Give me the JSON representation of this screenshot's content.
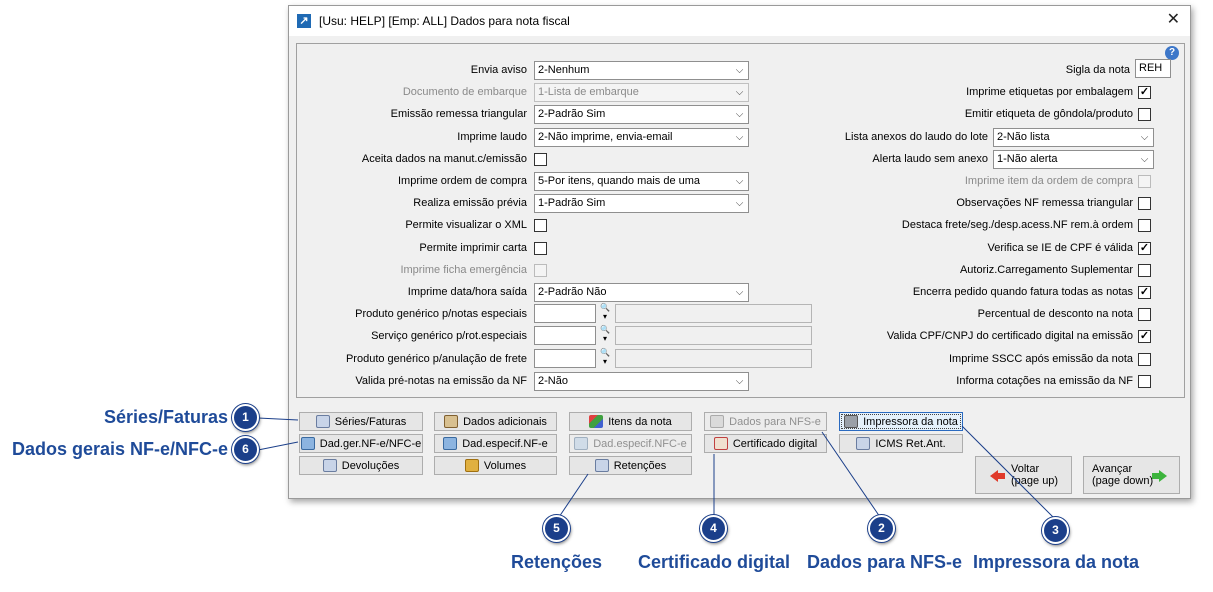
{
  "window": {
    "title": "[Usu: HELP] [Emp: ALL] Dados para nota fiscal",
    "close": "✕",
    "help": "?"
  },
  "left_fields": [
    {
      "label": "Envia aviso",
      "type": "combo",
      "value": "2-Nenhum"
    },
    {
      "label": "Documento de embarque",
      "type": "combo",
      "value": "1-Lista de embarque",
      "disabled": true
    },
    {
      "label": "Emissão remessa triangular",
      "type": "combo",
      "value": "2-Padrão Sim"
    },
    {
      "label": "Imprime laudo",
      "type": "combo",
      "value": "2-Não imprime, envia-email"
    },
    {
      "label": "Aceita dados na manut.c/emissão",
      "type": "check",
      "checked": false
    },
    {
      "label": "Imprime ordem de compra",
      "type": "combo",
      "value": "5-Por itens, quando mais de uma"
    },
    {
      "label": "Realiza emissão prévia",
      "type": "combo",
      "value": "1-Padrão Sim"
    },
    {
      "label": "Permite visualizar o XML",
      "type": "check",
      "checked": false
    },
    {
      "label": "Permite imprimir carta",
      "type": "check",
      "checked": false
    },
    {
      "label": "Imprime ficha emergência",
      "type": "check",
      "checked": false,
      "disabled": true
    },
    {
      "label": "Imprime data/hora saída",
      "type": "combo",
      "value": "2-Padrão Não"
    },
    {
      "label": "Produto genérico p/notas especiais",
      "type": "lookup",
      "value": "",
      "desc": ""
    },
    {
      "label": "Serviço genérico p/rot.especiais",
      "type": "lookup",
      "value": "",
      "desc": ""
    },
    {
      "label": "Produto genérico p/anulação de frete",
      "type": "lookup",
      "value": "",
      "desc": ""
    },
    {
      "label": "Valida pré-notas na emissão da NF",
      "type": "combo",
      "value": "2-Não"
    }
  ],
  "right_fields": [
    {
      "label": "Sigla da nota",
      "type": "text",
      "value": "REH"
    },
    {
      "label": "Imprime etiquetas por embalagem",
      "type": "check",
      "checked": true
    },
    {
      "label": "Emitir etiqueta de gôndola/produto",
      "type": "check",
      "checked": false
    },
    {
      "label": "Lista anexos do laudo do lote",
      "type": "combo",
      "value": "2-Não lista"
    },
    {
      "label": "Alerta laudo sem anexo",
      "type": "combo",
      "value": "1-Não alerta"
    },
    {
      "label": "Imprime item da ordem de compra",
      "type": "check",
      "checked": false,
      "disabled": true
    },
    {
      "label": "Observações NF remessa triangular",
      "type": "check",
      "checked": false
    },
    {
      "label": "Destaca frete/seg./desp.acess.NF rem.à ordem",
      "type": "check",
      "checked": false
    },
    {
      "label": "Verifica se IE de CPF é válida",
      "type": "check",
      "checked": true
    },
    {
      "label": "Autoriz.Carregamento Suplementar",
      "type": "check",
      "checked": false
    },
    {
      "label": "Encerra pedido quando fatura todas as notas",
      "type": "check",
      "checked": true
    },
    {
      "label": "Percentual de desconto na nota",
      "type": "check",
      "checked": false
    },
    {
      "label": "Valida CPF/CNPJ do certificado digital na emissão",
      "type": "check",
      "checked": true
    },
    {
      "label": "Imprime SSCC após emissão da nota",
      "type": "check",
      "checked": false
    },
    {
      "label": "Informa cotações na emissão da NF",
      "type": "check",
      "checked": false
    }
  ],
  "buttons": {
    "series": "Séries/Faturas",
    "dados_adicionais": "Dados adicionais",
    "itens_nota": "Itens da nota",
    "dados_nfse": "Dados para NFS-e",
    "impressora": "Impressora da nota",
    "dad_ger": "Dad.ger.NF-e/NFC-e",
    "dad_espec": "Dad.especif.NF-e",
    "dad_espec_nfce": "Dad.especif.NFC-e",
    "certificado": "Certificado digital",
    "icms": "ICMS Ret.Ant.",
    "devolucoes": "Devoluções",
    "volumes": "Volumes",
    "retencoes": "Retenções",
    "voltar": "Voltar",
    "voltar_sub": "(page up)",
    "avancar": "Avançar",
    "avancar_sub": "(page down)"
  },
  "callouts": [
    {
      "num": "1",
      "label": "Séries/Faturas"
    },
    {
      "num": "6",
      "label": "Dados gerais NF-e/NFC-e"
    },
    {
      "num": "5",
      "label": "Retenções"
    },
    {
      "num": "4",
      "label": "Certificado digital"
    },
    {
      "num": "2",
      "label": "Dados para NFS-e"
    },
    {
      "num": "3",
      "label": "Impressora da nota"
    }
  ],
  "colors": {
    "callout": "#1f4b99",
    "badge": "#1b3f8a"
  }
}
